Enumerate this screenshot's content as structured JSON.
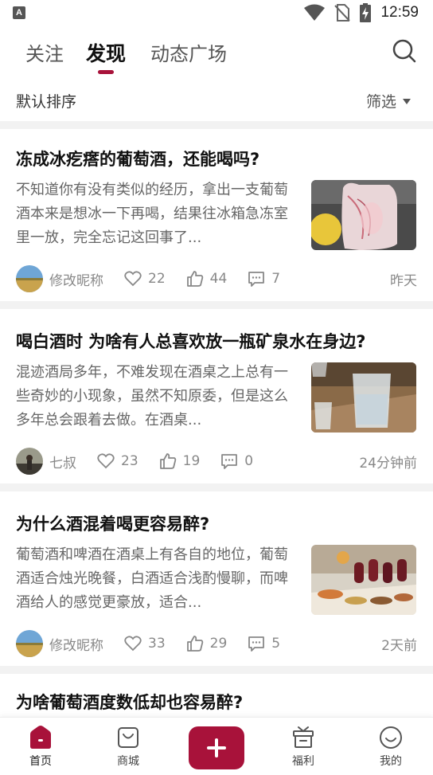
{
  "status_bar": {
    "time": "12:59",
    "app_badge": "A"
  },
  "tabs": [
    {
      "label": "关注"
    },
    {
      "label": "发现"
    },
    {
      "label": "动态广场"
    }
  ],
  "active_tab": "发现",
  "sort": {
    "label": "默认排序",
    "filter_label": "筛选"
  },
  "articles": [
    {
      "title": "冻成冰疙瘩的葡萄酒，还能喝吗?",
      "excerpt": "不知道你有没有类似的经历，拿出一支葡萄酒本来是想冰一下再喝，结果往冰箱急冻室里一放，完全忘记这回事了...",
      "author": "修改昵称",
      "likes": "22",
      "thumbs": "44",
      "comments": "7",
      "time": "昨天"
    },
    {
      "title": "喝白酒时 为啥有人总喜欢放一瓶矿泉水在身边?",
      "excerpt": "混迹酒局多年，不难发现在酒桌之上总有一些奇妙的小现象，虽然不知原委，但是这么多年总会跟着去做。在酒桌...",
      "author": "七叔",
      "likes": "23",
      "thumbs": "19",
      "comments": "0",
      "time": "24分钟前"
    },
    {
      "title": "为什么酒混着喝更容易醉?",
      "excerpt": "葡萄酒和啤酒在酒桌上有各自的地位，葡萄酒适合烛光晚餐，白酒适合浅酌慢聊，而啤酒给人的感觉更豪放，适合...",
      "author": "修改昵称",
      "likes": "33",
      "thumbs": "29",
      "comments": "5",
      "time": "2天前"
    }
  ],
  "partial_article": {
    "title": "为啥葡萄酒度数低却也容易醉?"
  },
  "bottom_nav": [
    {
      "label": "首页",
      "icon": "home-icon"
    },
    {
      "label": "商城",
      "icon": "shopping-bag-icon"
    },
    {
      "label": "福利",
      "icon": "gift-box-icon"
    },
    {
      "label": "我的",
      "icon": "smiley-icon"
    }
  ],
  "add_button": {
    "icon": "plus-icon"
  },
  "colors": {
    "accent": "#a8123a",
    "text_primary": "#111111",
    "text_secondary": "#666666",
    "divider": "#f2f2f2"
  }
}
